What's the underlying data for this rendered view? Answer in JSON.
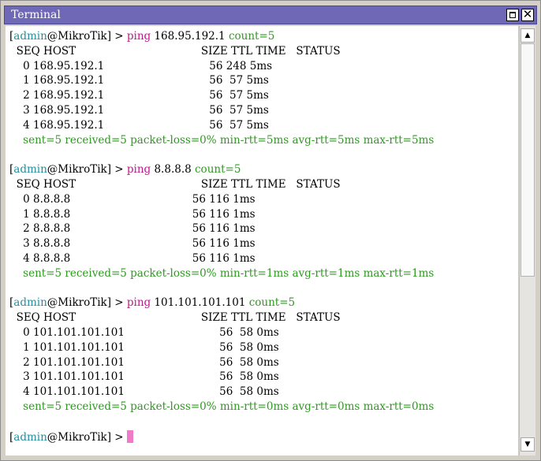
{
  "window": {
    "title": "Terminal",
    "close_glyph": "✕",
    "scroll_up_glyph": "▲",
    "scroll_down_glyph": "▼"
  },
  "colors": {
    "title_bar": "#6e68b6",
    "prompt_user": "#1f8fa0",
    "command": "#c0168c",
    "argument": "#2e9a20",
    "summary": "#2e9a20",
    "cursor": "#f07ac8"
  },
  "terminal": {
    "prompt": {
      "open": "[",
      "user": "admin",
      "host": "@MikroTik",
      "close": "] > "
    },
    "blocks": [
      {
        "command": "ping",
        "target": "168.95.192.1",
        "argument": "count=5",
        "header": "  SEQ HOST                                     SIZE TTL TIME   STATUS",
        "rows": [
          "    0 168.95.192.1                               56 248 5ms",
          "    1 168.95.192.1                               56  57 5ms",
          "    2 168.95.192.1                               56  57 5ms",
          "    3 168.95.192.1                               56  57 5ms",
          "    4 168.95.192.1                               56  57 5ms"
        ],
        "summary": "    sent=5 received=5 packet-loss=0% min-rtt=5ms avg-rtt=5ms max-rtt=5ms"
      },
      {
        "command": "ping",
        "target": "8.8.8.8",
        "argument": "count=5",
        "header": "  SEQ HOST                                     SIZE TTL TIME   STATUS",
        "rows": [
          "    0 8.8.8.8                                    56 116 1ms",
          "    1 8.8.8.8                                    56 116 1ms",
          "    2 8.8.8.8                                    56 116 1ms",
          "    3 8.8.8.8                                    56 116 1ms",
          "    4 8.8.8.8                                    56 116 1ms"
        ],
        "summary": "    sent=5 received=5 packet-loss=0% min-rtt=1ms avg-rtt=1ms max-rtt=1ms"
      },
      {
        "command": "ping",
        "target": "101.101.101.101",
        "argument": "count=5",
        "header": "  SEQ HOST                                     SIZE TTL TIME   STATUS",
        "rows": [
          "    0 101.101.101.101                            56  58 0ms",
          "    1 101.101.101.101                            56  58 0ms",
          "    2 101.101.101.101                            56  58 0ms",
          "    3 101.101.101.101                            56  58 0ms",
          "    4 101.101.101.101                            56  58 0ms"
        ],
        "summary": "    sent=5 received=5 packet-loss=0% min-rtt=0ms avg-rtt=0ms max-rtt=0ms"
      }
    ]
  }
}
